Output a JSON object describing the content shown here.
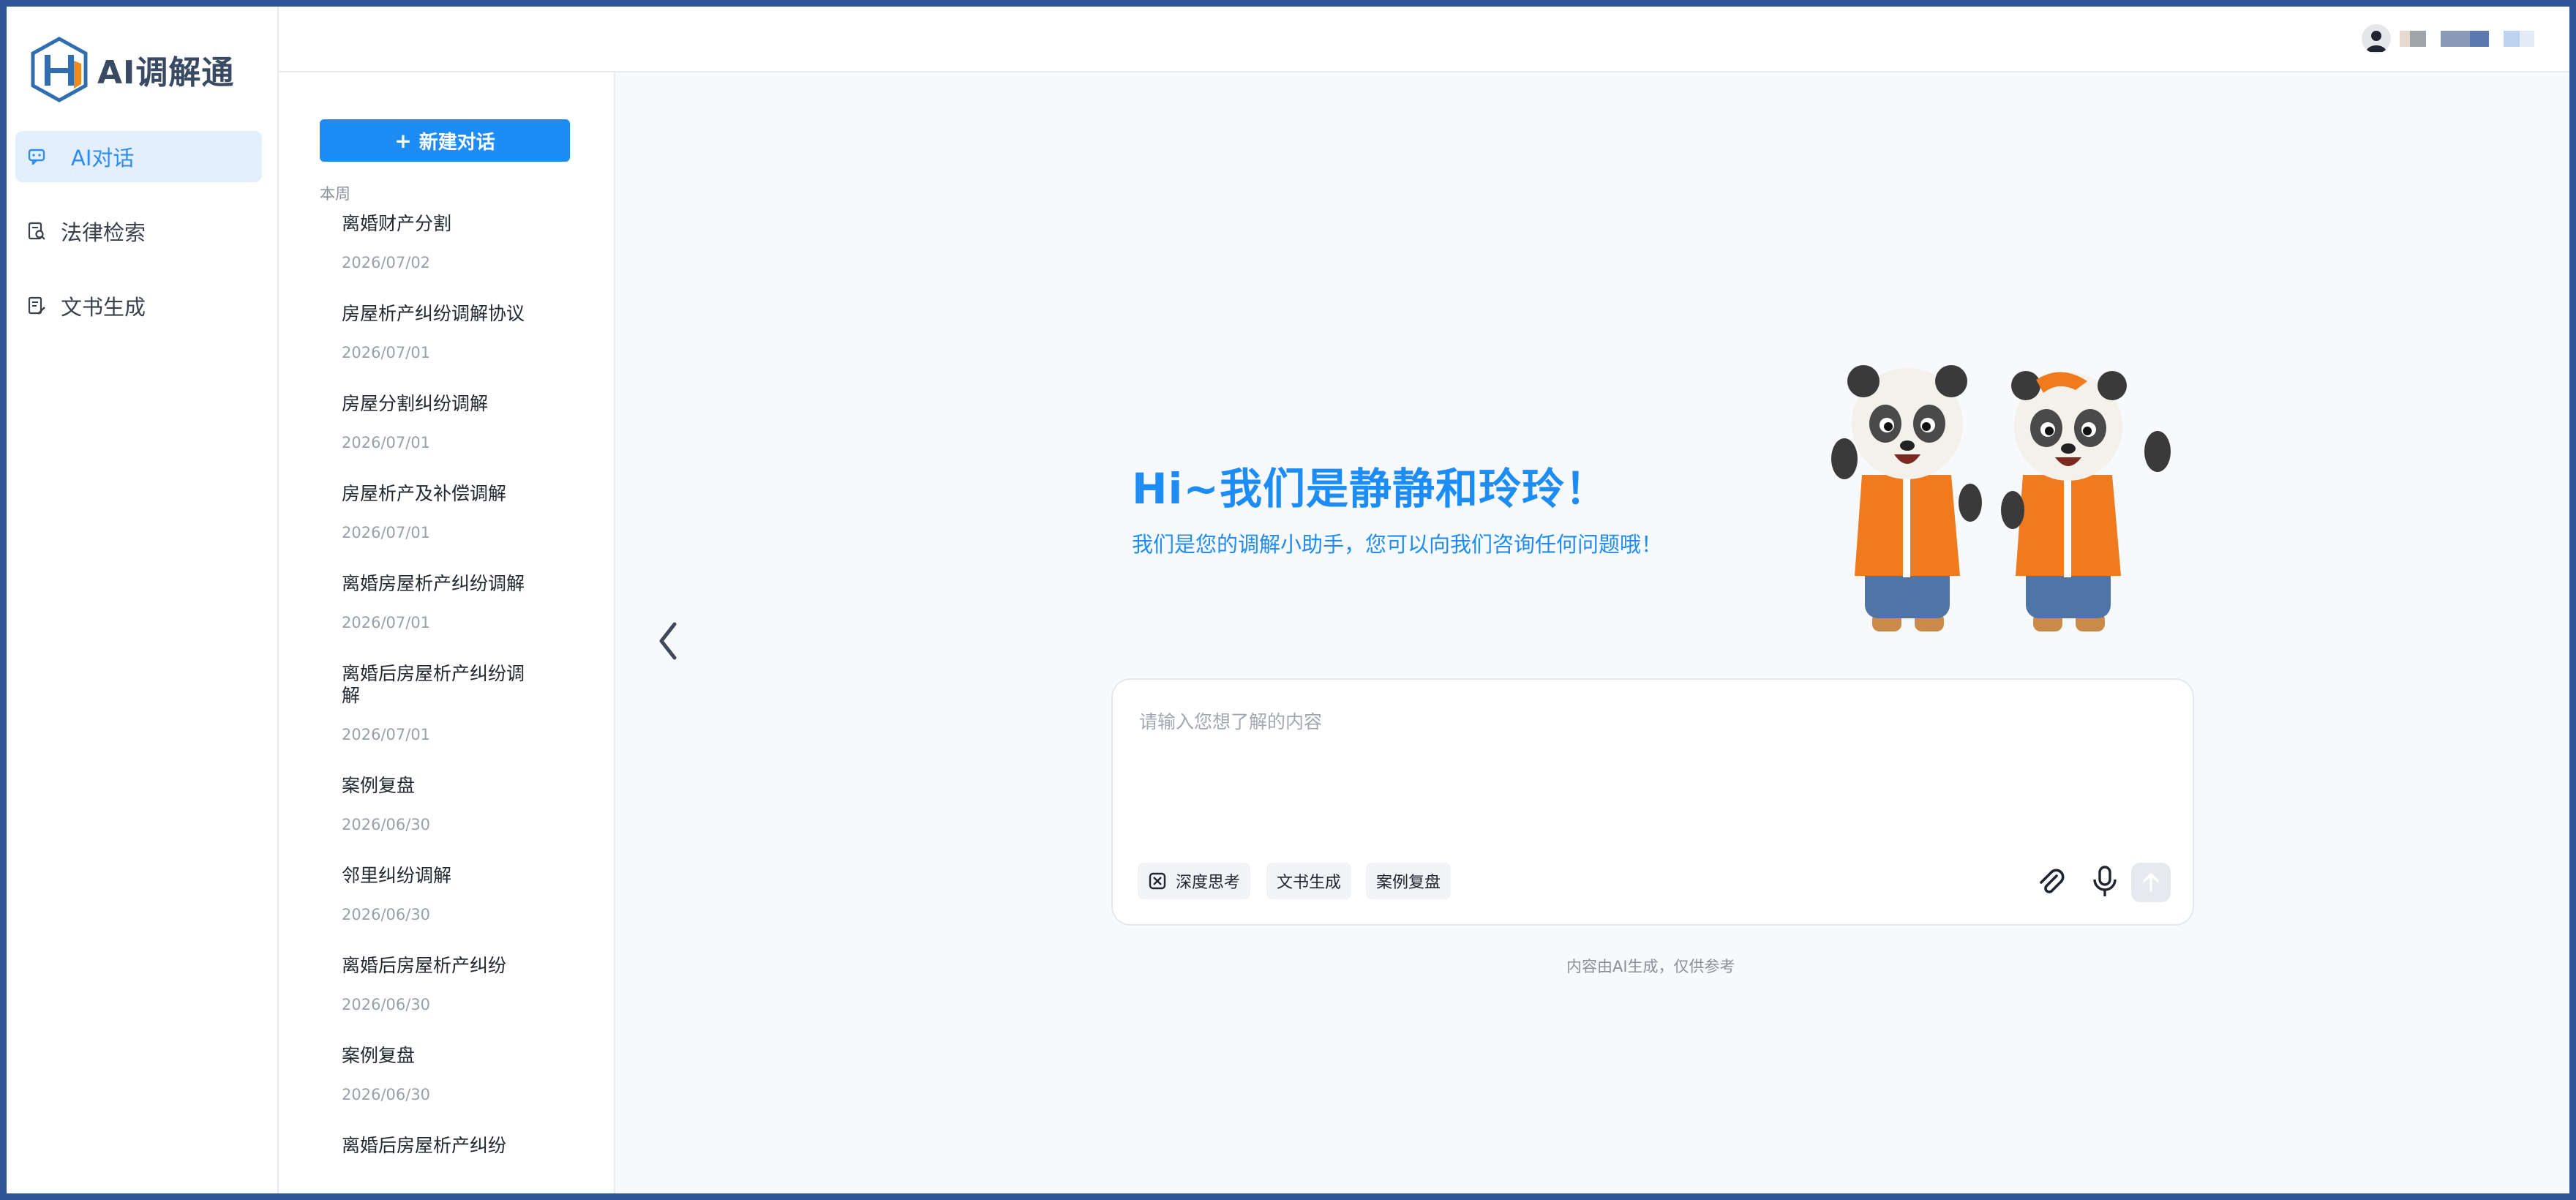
{
  "app": {
    "name": "AI调解通"
  },
  "nav": {
    "items": [
      {
        "label": "AI对话",
        "icon": "chat-icon",
        "active": true
      },
      {
        "label": "法律检索",
        "icon": "law-search-icon"
      },
      {
        "label": "文书生成",
        "icon": "document-icon"
      }
    ]
  },
  "history": {
    "new_button": "新建对话",
    "group_label": "本周",
    "items": [
      {
        "title": "离婚财产分割",
        "date": "2026/07/02"
      },
      {
        "title": "房屋析产纠纷调解协议",
        "date": "2026/07/01"
      },
      {
        "title": "房屋分割纠纷调解",
        "date": "2026/07/01"
      },
      {
        "title": "房屋析产及补偿调解",
        "date": "2026/07/01"
      },
      {
        "title": "离婚房屋析产纠纷调解",
        "date": "2026/07/01"
      },
      {
        "title": "离婚后房屋析产纠纷调解",
        "date": "2026/07/01"
      },
      {
        "title": "案例复盘",
        "date": "2026/06/30"
      },
      {
        "title": "邻里纠纷调解",
        "date": "2026/06/30"
      },
      {
        "title": "离婚后房屋析产纠纷",
        "date": "2026/06/30"
      },
      {
        "title": "案例复盘",
        "date": "2026/06/30"
      },
      {
        "title": "离婚后房屋析产纠纷",
        "date": ""
      }
    ]
  },
  "hero": {
    "title": "Hi~我们是静静和玲玲！",
    "subtitle": "我们是您的调解小助手，您可以向我们咨询任何问题哦！"
  },
  "input": {
    "placeholder": "请输入您想了解的内容",
    "chips": [
      {
        "label": "深度思考",
        "icon": "deep-think-icon"
      },
      {
        "label": "文书生成"
      },
      {
        "label": "案例复盘"
      }
    ]
  },
  "footer": {
    "disclaimer": "内容由AI生成，仅供参考"
  },
  "colors": {
    "accent": "#1e8cf5",
    "frame": "#2f5499",
    "active_nav_bg": "#e3effd"
  }
}
